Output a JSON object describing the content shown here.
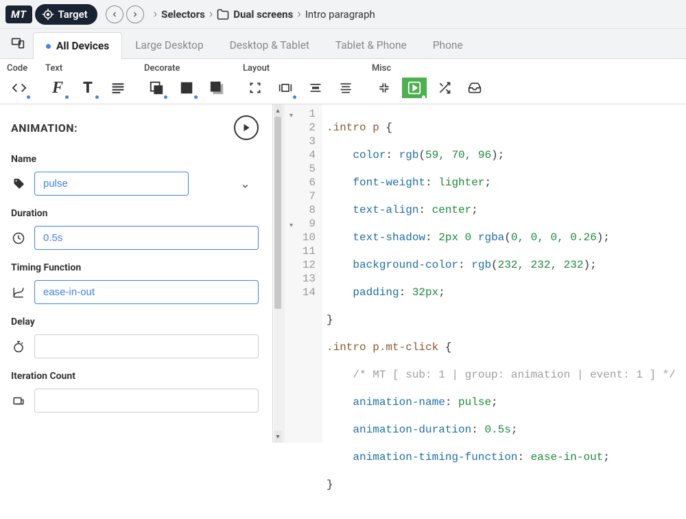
{
  "logo": "MT",
  "target_label": "Target",
  "breadcrumbs": [
    {
      "label": "Selectors",
      "bold": true,
      "icon": null
    },
    {
      "label": "Dual screens",
      "bold": true,
      "icon": "folder"
    },
    {
      "label": "Intro paragraph",
      "bold": false,
      "icon": null
    }
  ],
  "tabs": [
    {
      "label": "All Devices",
      "active": true,
      "dot": true
    },
    {
      "label": "Large Desktop",
      "active": false,
      "dot": false
    },
    {
      "label": "Desktop & Tablet",
      "active": false,
      "dot": false
    },
    {
      "label": "Tablet & Phone",
      "active": false,
      "dot": false
    },
    {
      "label": "Phone",
      "active": false,
      "dot": false
    }
  ],
  "toolbar_groups": [
    {
      "label": "Code"
    },
    {
      "label": "Text"
    },
    {
      "label": "Decorate"
    },
    {
      "label": "Layout"
    },
    {
      "label": "Misc"
    }
  ],
  "panel": {
    "title": "ANIMATION:",
    "fields": {
      "name": {
        "label": "Name",
        "value": "pulse"
      },
      "duration": {
        "label": "Duration",
        "value": "0.5s"
      },
      "timing": {
        "label": "Timing Function",
        "value": "ease-in-out"
      },
      "delay": {
        "label": "Delay",
        "value": ""
      },
      "iteration": {
        "label": "Iteration Count",
        "value": ""
      }
    }
  },
  "code_lines": 14,
  "code": {
    "l1": {
      "sel": ".intro p",
      "rest": " {"
    },
    "l2": {
      "prop": "color",
      "val": "rgb(59, 70, 96)"
    },
    "l3": {
      "prop": "font-weight",
      "val": "lighter"
    },
    "l4": {
      "prop": "text-align",
      "val": "center"
    },
    "l5": {
      "prop": "text-shadow",
      "nums": "2px 0",
      "func": "rgba",
      "args": "(0, 0, 0, 0.26)"
    },
    "l6": {
      "prop": "background-color",
      "func": "rgb",
      "args": "(232, 232, 232)"
    },
    "l7": {
      "prop": "padding",
      "val": "32px"
    },
    "l8": {
      "brace": "}"
    },
    "l9": {
      "sel": ".intro p.mt-click",
      "rest": " {"
    },
    "l10": {
      "comment": "/* MT [ sub: 1 | group: animation | event: 1 ] */"
    },
    "l11": {
      "prop": "animation-name",
      "val": "pulse"
    },
    "l12": {
      "prop": "animation-duration",
      "val": "0.5s"
    },
    "l13": {
      "prop": "animation-timing-function",
      "val": "ease-in-out"
    },
    "l14": {
      "brace": "}"
    }
  }
}
